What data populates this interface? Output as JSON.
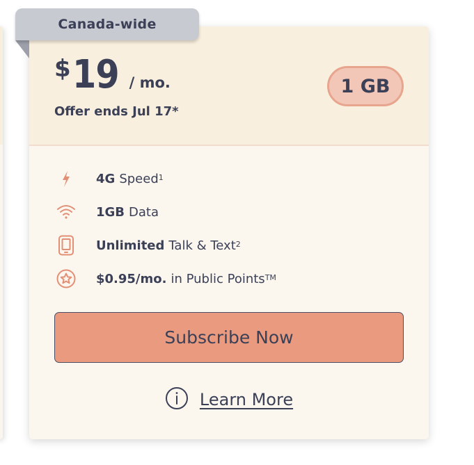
{
  "colors": {
    "text": "#3b4057",
    "accent": "#ea9b7f",
    "icon": "#e38f76",
    "ribbon": "#c8cad2",
    "header_bg": "#f9efde",
    "card_bg": "#fbf7ef"
  },
  "card": {
    "ribbon_label": "Canada-wide",
    "price": {
      "currency": "$",
      "amount": "19",
      "period": "/ mo."
    },
    "offer_text": "Offer ends Jul 17*",
    "data_badge": "1 GB",
    "features": [
      {
        "icon": "lightning-icon",
        "bold": "4G",
        "text": "Speed",
        "sup": "1"
      },
      {
        "icon": "wifi-icon",
        "bold": "1GB",
        "text": "Data",
        "sup": ""
      },
      {
        "icon": "phone-icon",
        "bold": "Unlimited",
        "text": "Talk & Text",
        "sup": "2"
      },
      {
        "icon": "star-icon",
        "bold": "$0.95/mo.",
        "text": "in Public Points",
        "sup": "TM"
      }
    ],
    "cta_label": "Subscribe Now",
    "learn_more_label": "Learn More"
  }
}
